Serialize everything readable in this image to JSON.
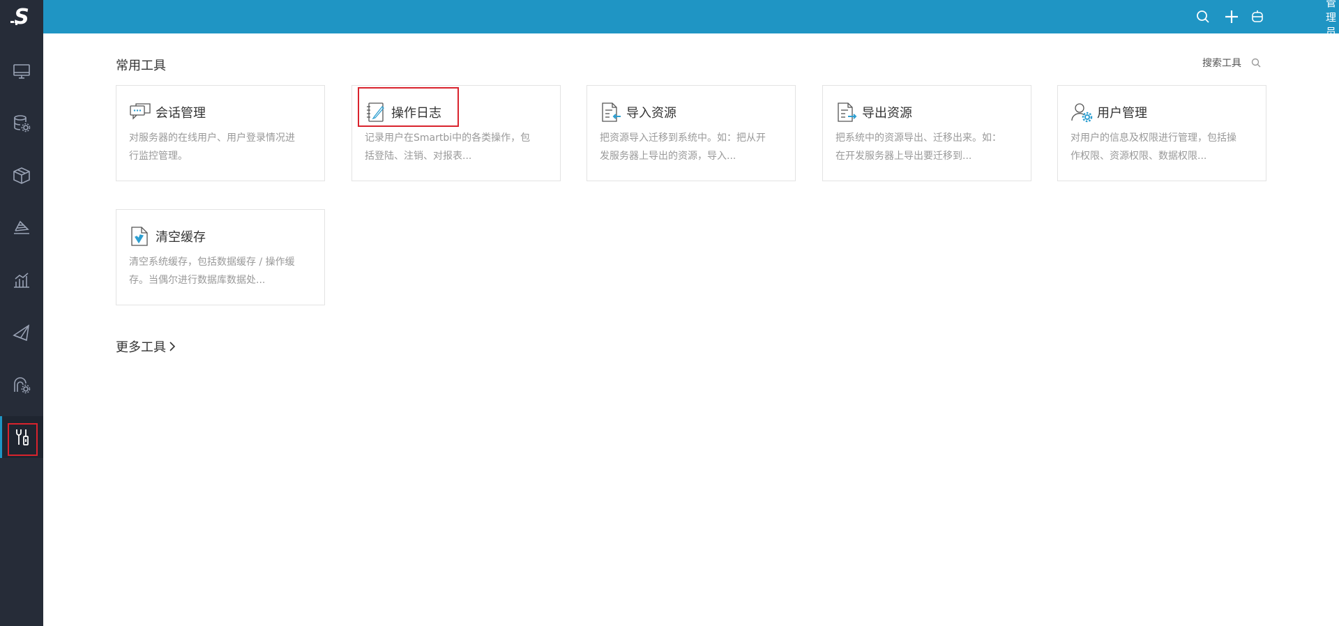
{
  "app": {
    "logo_letter": "S",
    "colors": {
      "sidebar_bg": "#262c38",
      "topbar_bg": "#1f95c4",
      "icon_blue": "#2e9fd1",
      "highlight_red": "#d9232d"
    }
  },
  "sidebar": {
    "items": [
      {
        "name": "sidebar-item-analysis",
        "icon": "monitor-icon"
      },
      {
        "name": "sidebar-item-data",
        "icon": "database-gear-icon"
      },
      {
        "name": "sidebar-item-model",
        "icon": "cube-icon"
      },
      {
        "name": "sidebar-item-mining",
        "icon": "layers-icon"
      },
      {
        "name": "sidebar-item-report",
        "icon": "bar-chart-icon"
      },
      {
        "name": "sidebar-item-publish",
        "icon": "paper-plane-icon"
      },
      {
        "name": "sidebar-item-ops",
        "icon": "user-gear-icon"
      },
      {
        "name": "sidebar-item-system",
        "icon": "tools-icon",
        "active": true
      }
    ]
  },
  "topbar": {
    "icons": [
      "search-icon",
      "plus-icon",
      "robot-icon"
    ],
    "user_label": "管理员"
  },
  "main": {
    "section_title": "常用工具",
    "search_label": "搜索工具",
    "more_tools_label": "更多工具"
  },
  "cards": [
    {
      "title": "会话管理",
      "desc_1": "对服务器的在线用户、用户登录情况进",
      "desc_2": "行监控管理。",
      "icon": "chat-icon"
    },
    {
      "title": "操作日志",
      "desc_1": "记录用户在Smartbi中的各类操作，包",
      "desc_2": "括登陆、注销、对报表...",
      "icon": "log-edit-icon"
    },
    {
      "title": "导入资源",
      "desc_1": "把资源导入迁移到系统中。如：把从开",
      "desc_2": "发服务器上导出的资源，导入...",
      "icon": "import-icon"
    },
    {
      "title": "导出资源",
      "desc_1": "把系统中的资源导出、迁移出来。如：",
      "desc_2": "在开发服务器上导出要迁移到...",
      "icon": "export-icon"
    },
    {
      "title": "用户管理",
      "desc_1": "对用户的信息及权限进行管理，包括操",
      "desc_2": "作权限、资源权限、数据权限...",
      "icon": "user-settings-icon"
    },
    {
      "title": "清空缓存",
      "desc_1": "清空系统缓存，包括数据缓存 / 操作缓",
      "desc_2": "存。当偶尔进行数据库数据处...",
      "icon": "clear-cache-icon"
    }
  ]
}
